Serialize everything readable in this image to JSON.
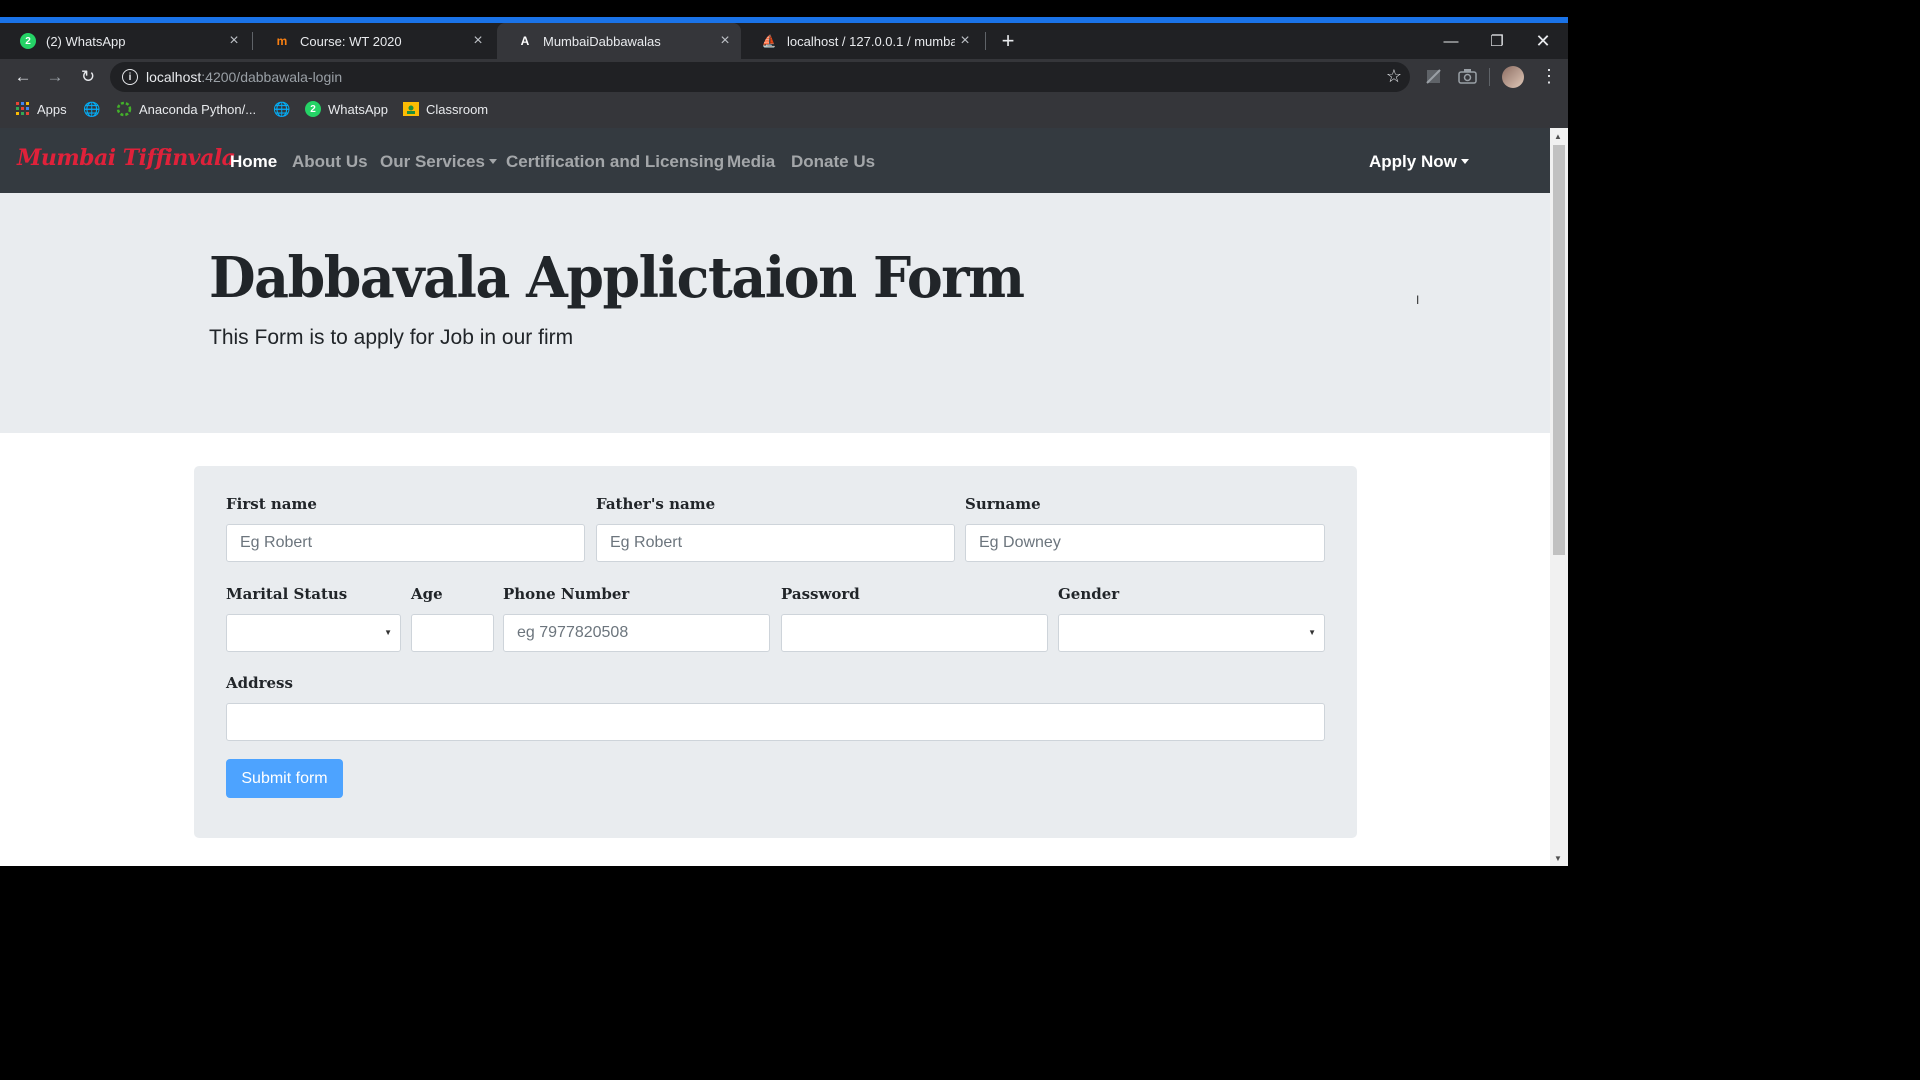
{
  "browser": {
    "tabs": [
      {
        "title": "(2) WhatsApp",
        "icon": "whatsapp-icon"
      },
      {
        "title": "Course: WT 2020",
        "icon": "moodle-icon"
      },
      {
        "title": "MumbaiDabbawalas",
        "icon": "angular-icon"
      },
      {
        "title": "localhost / 127.0.0.1 / mumbaida",
        "icon": "phpmyadmin-icon"
      }
    ],
    "url_host": "localhost",
    "url_path": ":4200/dabbawala-login",
    "bookmarks": {
      "apps": "Apps",
      "anaconda": "Anaconda Python/...",
      "whatsapp": "WhatsApp",
      "classroom": "Classroom"
    },
    "colors": {
      "accent": "#1a73e8",
      "tab_bg": "#202124",
      "toolbar_bg": "#35363a"
    }
  },
  "site": {
    "brand": "Mumbai Tiffinvala",
    "nav": {
      "home": "Home",
      "about": "About Us",
      "services": "Our Services",
      "certification": "Certification and Licensing",
      "media": "Media",
      "donate": "Donate Us",
      "apply": "Apply Now"
    },
    "colors": {
      "navbar": "#343a40",
      "brand": "#e0213a",
      "button": "#4da3ff"
    }
  },
  "jumbotron": {
    "title": "Dabbavala Applictaion Form",
    "subtitle": "This Form is to apply for Job in our firm"
  },
  "form": {
    "first_name": {
      "label": "First name",
      "placeholder": "Eg Robert"
    },
    "fathers_name": {
      "label": "Father's name",
      "placeholder": "Eg Robert"
    },
    "surname": {
      "label": "Surname",
      "placeholder": "Eg Downey"
    },
    "marital_status": {
      "label": "Marital Status"
    },
    "age": {
      "label": "Age"
    },
    "phone": {
      "label": "Phone Number",
      "placeholder": "eg 7977820508"
    },
    "password": {
      "label": "Password"
    },
    "gender": {
      "label": "Gender"
    },
    "address": {
      "label": "Address"
    },
    "submit": "Submit form"
  }
}
